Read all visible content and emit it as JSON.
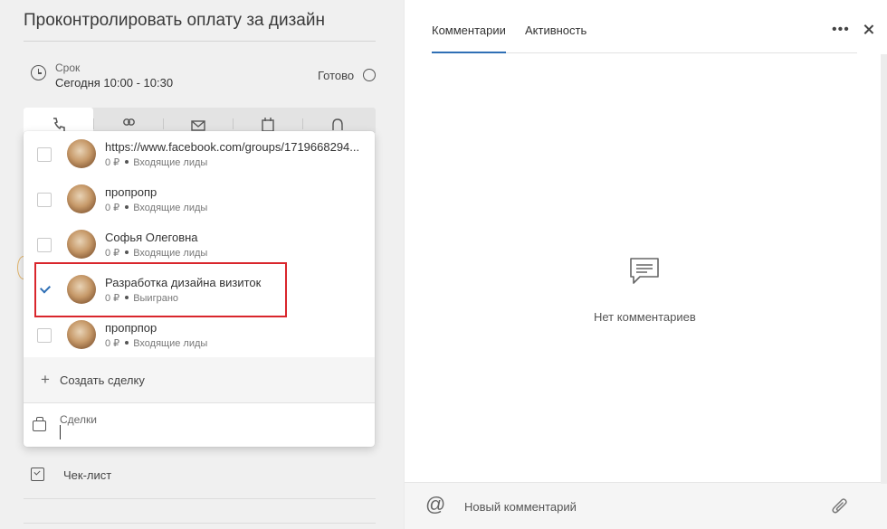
{
  "task": {
    "title": "Проконтролировать оплату за дизайн",
    "deadline_label": "Срок",
    "deadline_value": "Сегодня 10:00 - 10:30",
    "done_label": "Готово"
  },
  "type_tabs": [
    {
      "icon": "phone-icon"
    },
    {
      "icon": "people-icon"
    },
    {
      "icon": "mail-icon"
    },
    {
      "icon": "calendar-icon"
    },
    {
      "icon": "bell-icon"
    }
  ],
  "deals": [
    {
      "name": "https://www.facebook.com/groups/1719668294...",
      "amount": "0 ₽",
      "stage": "Входящие лиды",
      "checked": false
    },
    {
      "name": "пропропр",
      "amount": "0 ₽",
      "stage": "Входящие лиды",
      "checked": false
    },
    {
      "name": "Софья Олеговна",
      "amount": "0 ₽",
      "stage": "Входящие лиды",
      "checked": false
    },
    {
      "name": "Разработка дизайна визиток",
      "amount": "0 ₽",
      "stage": "Выиграно",
      "checked": true
    },
    {
      "name": "пропрпор",
      "amount": "0 ₽",
      "stage": "Входящие лиды",
      "checked": false
    }
  ],
  "create_deal_label": "Создать сделку",
  "deals_field_label": "Сделки",
  "checklist_label": "Чек-лист",
  "right_tabs": [
    {
      "label": "Комментарии",
      "active": true
    },
    {
      "label": "Активность",
      "active": false
    }
  ],
  "no_comments": "Нет комментариев",
  "comment_placeholder": "Новый комментарий",
  "colors": {
    "accent": "#2f6fb5",
    "highlight": "#d9262c"
  }
}
